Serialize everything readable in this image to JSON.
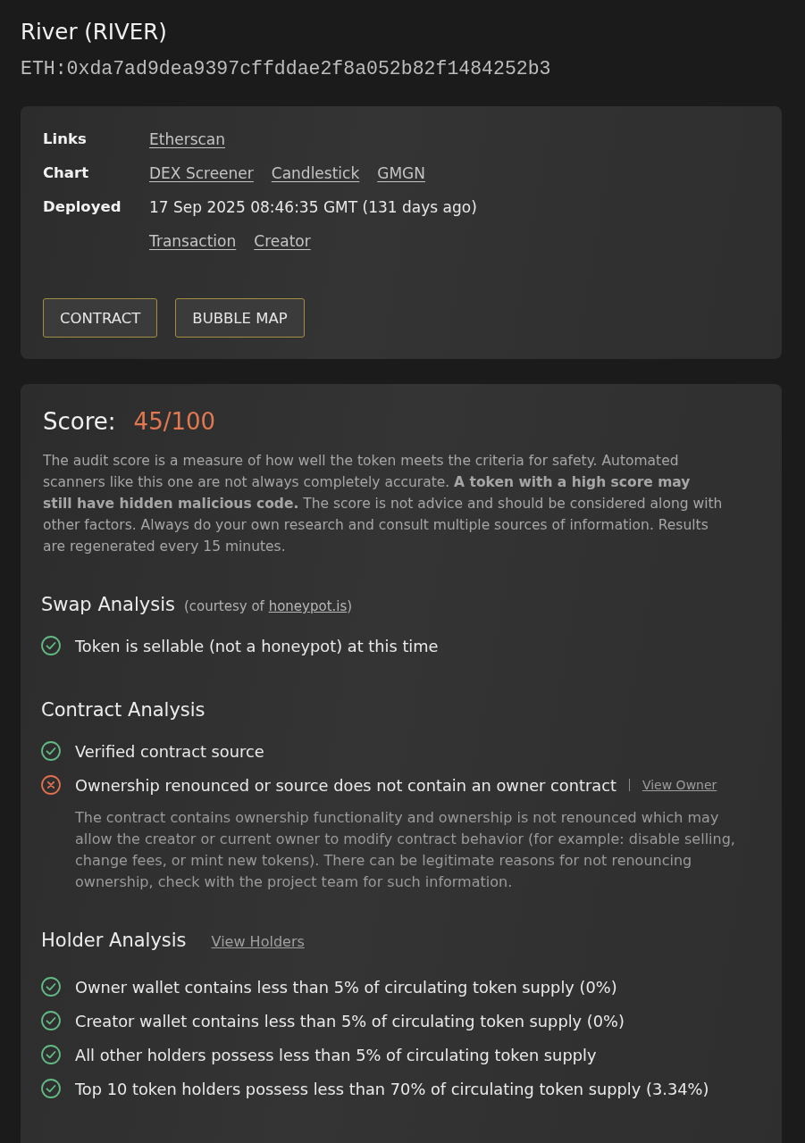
{
  "header": {
    "title": "River (RIVER)",
    "address": "ETH:0xda7ad9dea9397cffddae2f8a052b82f1484252b3"
  },
  "info_card": {
    "rows": [
      {
        "label": "Links",
        "links": [
          "Etherscan"
        ]
      },
      {
        "label": "Chart",
        "links": [
          "DEX Screener",
          "Candlestick",
          "GMGN"
        ]
      },
      {
        "label": "Deployed",
        "value": "17 Sep 2025 08:46:35 GMT (131 days ago)",
        "links": [
          "Transaction",
          "Creator"
        ]
      }
    ],
    "buttons": [
      "CONTRACT",
      "BUBBLE MAP"
    ]
  },
  "audit": {
    "score_label": "Score:",
    "score": "45/100",
    "disclaimer": "The audit score is a measure of how well the token meets the criteria for safety. Automated scanners like this one are not always completely accurate. **A token with a high score may still have hidden malicious code.** The score is not advice and should be considered along with other factors. Always do your own research and consult multiple sources of information. Results are regenerated every 15 minutes.",
    "sections": [
      {
        "title": "Swap Analysis",
        "note": {
          "before": "(courtesy of ",
          "link": "honeypot.is",
          "after": ")"
        },
        "checks": [
          {
            "text": "Token is sellable (not a honeypot) at this time",
            "passed": true
          }
        ]
      },
      {
        "title": "Contract Analysis",
        "checks": [
          {
            "text": "Verified contract source",
            "passed": true
          },
          {
            "text": "Ownership renounced or source does not contain an owner contract",
            "passed": false,
            "link": "View Owner",
            "details": "The contract contains ownership functionality and ownership is not renounced which may allow the creator or current owner to modify contract behavior (for example: disable selling, change fees, or mint new tokens). There can be legitimate reasons for not renouncing ownership, check with the project team for such information."
          }
        ]
      },
      {
        "title": "Holder Analysis",
        "link": "View Holders",
        "checks": [
          {
            "text": "Owner wallet contains less than 5% of circulating token supply (0%)",
            "passed": true
          },
          {
            "text": "Creator wallet contains less than 5% of circulating token supply (0%)",
            "passed": true
          },
          {
            "text": "All other holders possess less than 5% of circulating token supply",
            "passed": true
          },
          {
            "text": "Top 10 token holders possess less than 70% of circulating token supply (3.34%)",
            "passed": true
          }
        ]
      }
    ]
  }
}
